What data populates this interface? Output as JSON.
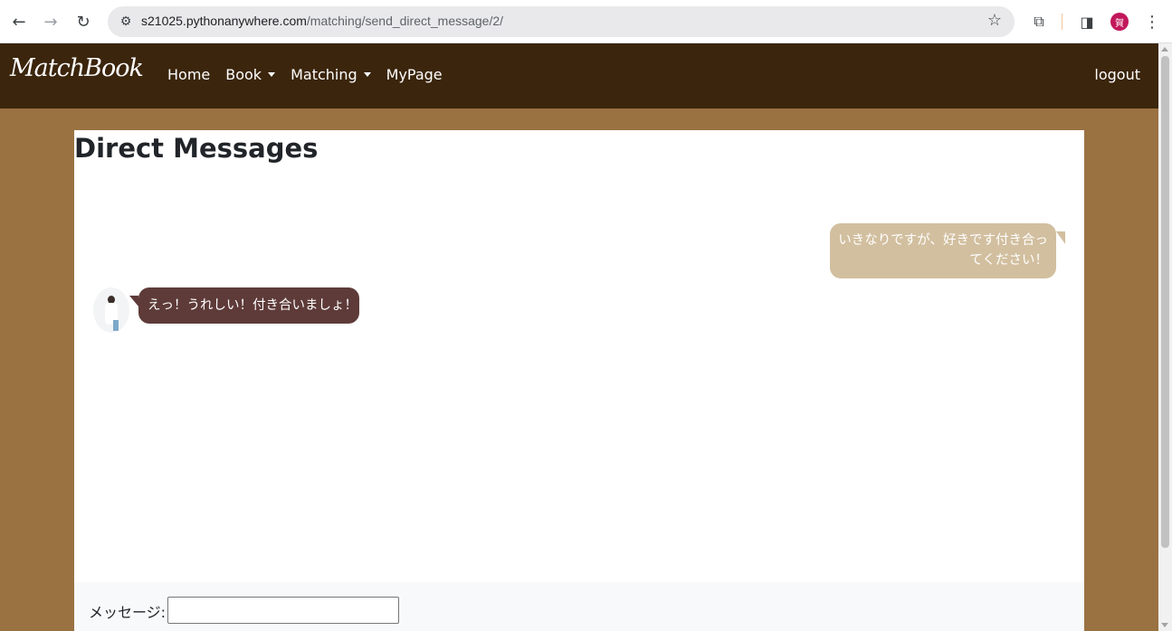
{
  "browser": {
    "url_host": "s21025.pythonanywhere.com",
    "url_path": "/matching/send_direct_message/2/",
    "profile_initial": "賀"
  },
  "navbar": {
    "brand": "MatchBook",
    "links": [
      {
        "label": "Home"
      },
      {
        "label": "Book"
      },
      {
        "label": "Matching"
      },
      {
        "label": "MyPage"
      }
    ],
    "logout": "logout"
  },
  "page": {
    "title": "Direct Messages"
  },
  "messages": [
    {
      "sender": "me",
      "text": "いきなりですが、好きです付き合ってください！"
    },
    {
      "sender": "them",
      "text": "えっ！うれしい！付き合いましょ！"
    }
  ],
  "form": {
    "label": "メッセージ:",
    "value": ""
  },
  "colors": {
    "navbar": "#3b250c",
    "page_bg": "#9a7242",
    "my_bubble": "#d2bf9f",
    "their_bubble": "#5e3b39"
  }
}
